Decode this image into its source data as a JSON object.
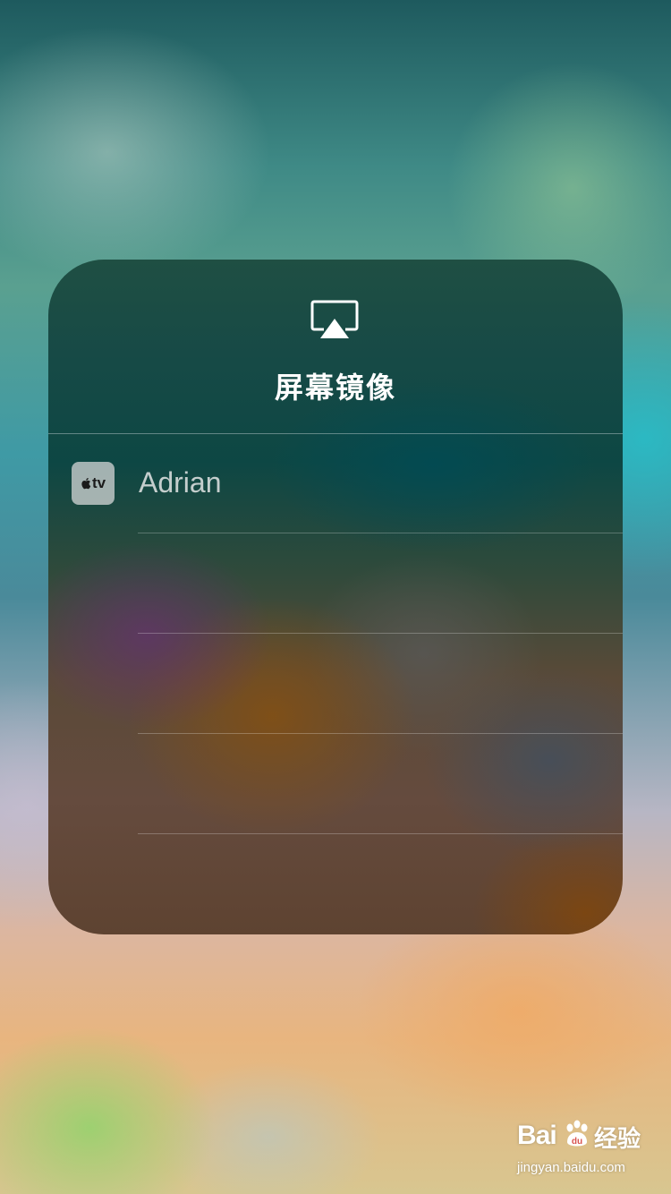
{
  "panel": {
    "title": "屏幕镜像",
    "icon": "airplay-icon",
    "devices": [
      {
        "name": "Adrian",
        "icon": "appletv-icon",
        "badge": "tv"
      }
    ]
  },
  "watermark": {
    "logo": "Bai",
    "paw_logo": "du",
    "text": "经验",
    "url": "jingyan.baidu.com"
  },
  "colors": {
    "title_text": "#ffffff",
    "device_text": "#ebebeb",
    "icon_tile": "#dcdcdc"
  }
}
